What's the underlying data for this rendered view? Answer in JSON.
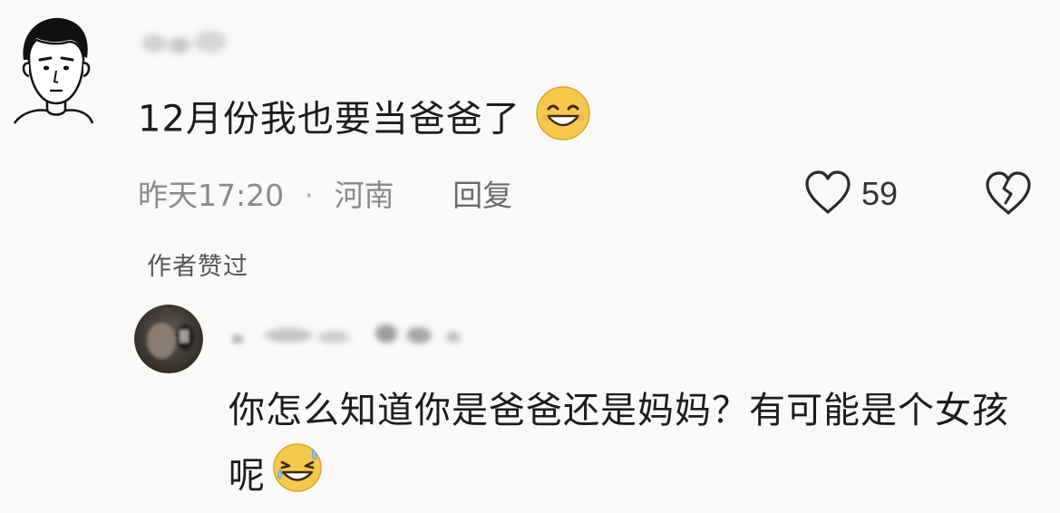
{
  "comment": {
    "text": "12月份我也要当爸爸了",
    "emoji": "grinning-emoji",
    "time": "昨天17:20",
    "separator": "·",
    "location": "河南",
    "reply_label": "回复",
    "like_count": "59",
    "author_liked": "作者赞过"
  },
  "reply": {
    "text": "你怎么知道你是爸爸还是妈妈？有可能是个女孩呢",
    "emoji": "laughing-tears-emoji"
  },
  "colors": {
    "background": "#f9f9f7",
    "text": "#1c1c1c",
    "meta": "#8a8a8a",
    "emoji_yellow": "#f5c84b"
  }
}
